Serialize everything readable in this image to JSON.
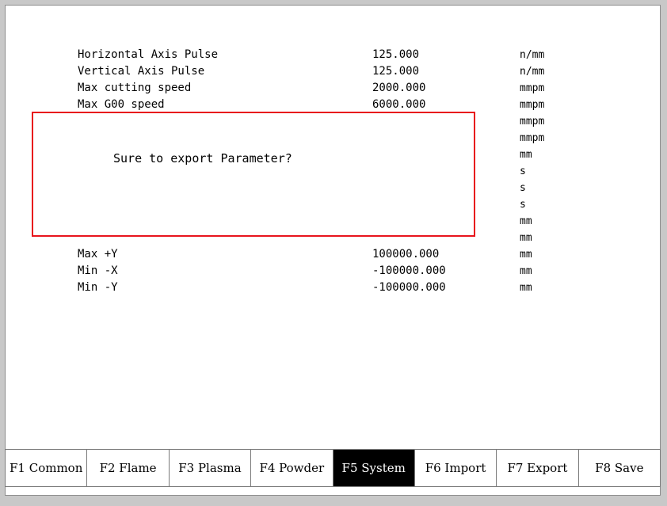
{
  "parameters": [
    {
      "name": "Horizontal Axis Pulse",
      "value": "125.000",
      "unit": "n/mm"
    },
    {
      "name": "Vertical Axis Pulse",
      "value": "125.000",
      "unit": "n/mm"
    },
    {
      "name": "Max cutting speed",
      "value": "2000.000",
      "unit": "mmpm"
    },
    {
      "name": "Max G00 speed",
      "value": "6000.000",
      "unit": "mmpm"
    },
    {
      "name": "",
      "value": "",
      "unit": "mmpm"
    },
    {
      "name": "",
      "value": "",
      "unit": "mmpm"
    },
    {
      "name": "",
      "value": "",
      "unit": "mm"
    },
    {
      "name": "",
      "value": "",
      "unit": "s"
    },
    {
      "name": "",
      "value": "",
      "unit": "s"
    },
    {
      "name": "",
      "value": "",
      "unit": "s"
    },
    {
      "name": "",
      "value": "",
      "unit": "mm"
    },
    {
      "name": "",
      "value": "",
      "unit": "mm"
    },
    {
      "name": "Max +Y",
      "value": "100000.000",
      "unit": "mm"
    },
    {
      "name": "Min -X",
      "value": "-100000.000",
      "unit": "mm"
    },
    {
      "name": "Min -Y",
      "value": "-100000.000",
      "unit": "mm"
    }
  ],
  "dialog": {
    "message": "Sure to export Parameter?",
    "border_color": "#e8141c"
  },
  "fkeys": [
    {
      "label": "F1 Common"
    },
    {
      "label": "F2 Flame"
    },
    {
      "label": "F3 Plasma"
    },
    {
      "label": "F4 Powder"
    },
    {
      "label": "F5 System"
    },
    {
      "label": "F6 Import"
    },
    {
      "label": "F7 Export"
    },
    {
      "label": "F8 Save"
    }
  ],
  "active_fkey": "F5 System"
}
